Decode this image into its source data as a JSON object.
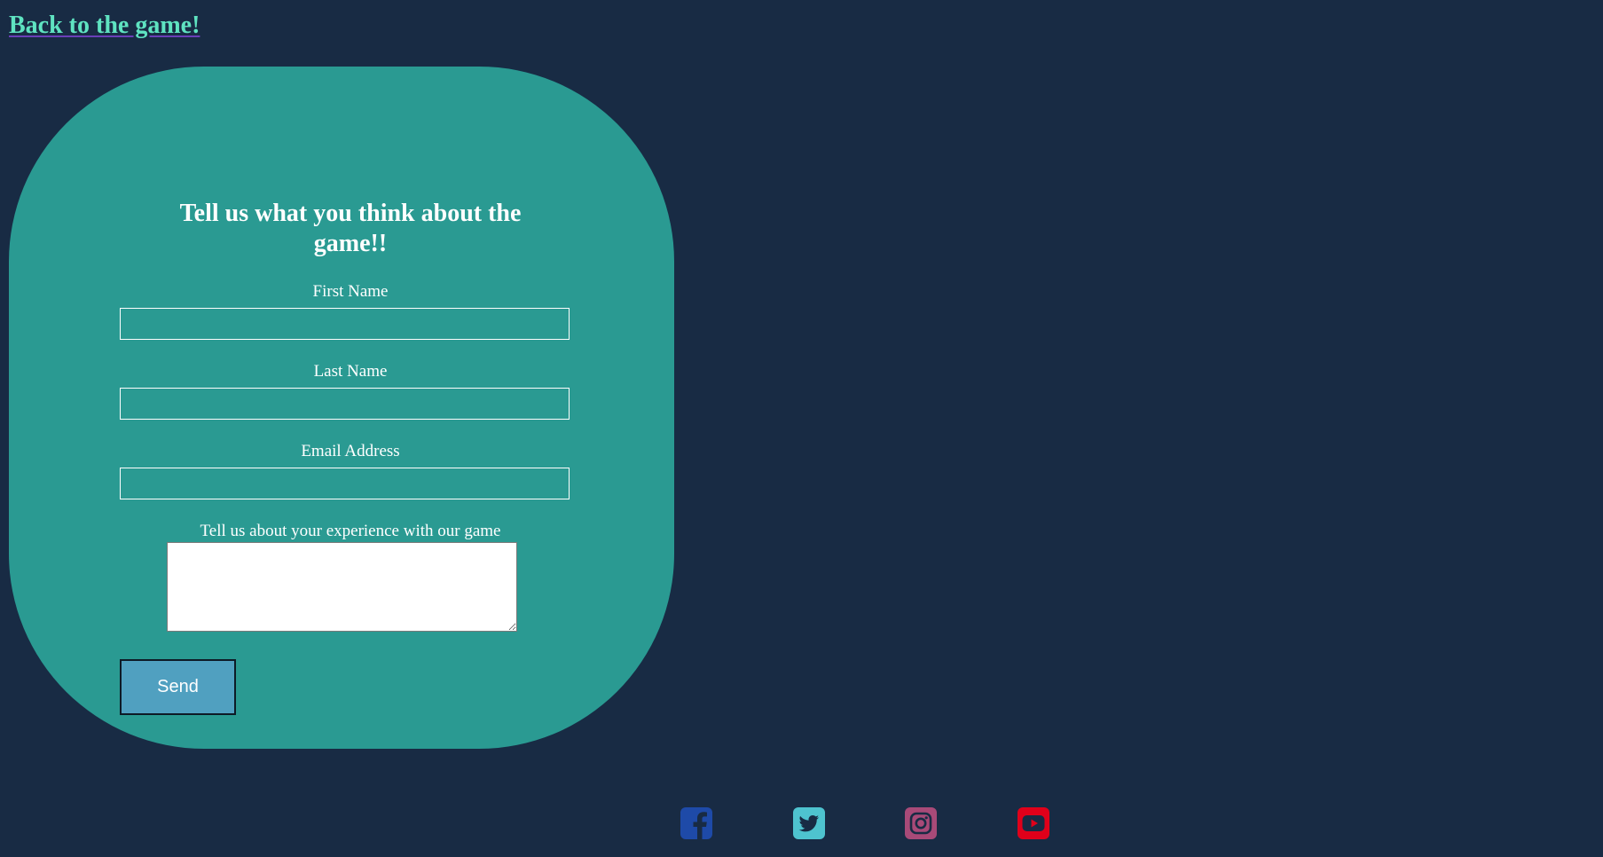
{
  "back_link": {
    "label": "Back to the game!"
  },
  "form": {
    "title": "Tell us what you think about the game!!",
    "fields": [
      {
        "label": "First Name",
        "value": ""
      },
      {
        "label": "Last Name",
        "value": ""
      },
      {
        "label": "Email Address",
        "value": ""
      }
    ],
    "experience": {
      "label": "Tell us about your experience with our game",
      "value": ""
    },
    "send_label": "Send"
  },
  "social": [
    {
      "name": "facebook-icon",
      "color": "#1e4aa8"
    },
    {
      "name": "twitter-icon",
      "color": "#4ec3cf"
    },
    {
      "name": "instagram-icon",
      "color": "#a84a78"
    },
    {
      "name": "youtube-icon",
      "color": "#e0001a"
    }
  ],
  "colors": {
    "background": "#182b44",
    "card": "#2a9a92",
    "link": "#5fe3c1",
    "button": "#50a0c0"
  }
}
